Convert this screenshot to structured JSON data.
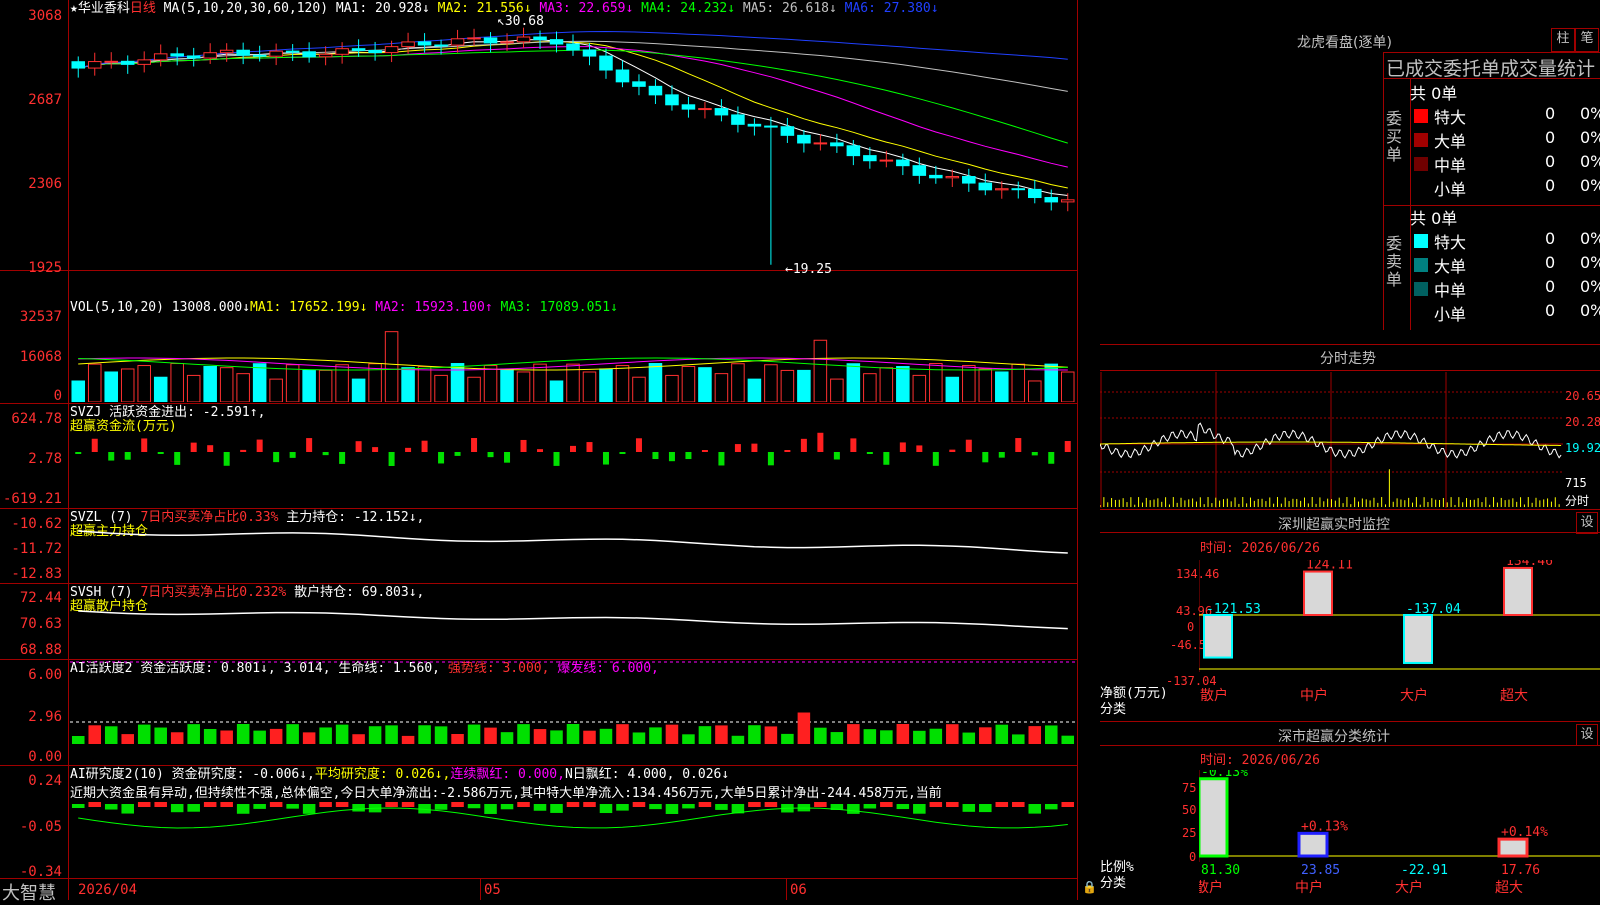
{
  "app": {
    "brand": "大智慧"
  },
  "main": {
    "stock_name": "★华业香科",
    "period": "日线",
    "ma_params": "MA(5,10,20,30,60,120)",
    "ma": [
      {
        "label": "MA1:",
        "value": "20.928↓",
        "color": "#ffffff"
      },
      {
        "label": "MA2:",
        "value": "21.556↓",
        "color": "#ffff00"
      },
      {
        "label": "MA3:",
        "value": "22.659↓",
        "color": "#ff00ff"
      },
      {
        "label": "MA4:",
        "value": "24.232↓",
        "color": "#00ff00"
      },
      {
        "label": "MA5:",
        "value": "26.618↓",
        "color": "#c0c0c0"
      },
      {
        "label": "MA6:",
        "value": "27.380↓",
        "color": "#2040ff"
      }
    ],
    "y_labels": [
      "3068",
      "2687",
      "2306",
      "1925"
    ],
    "high_marker": "30.68",
    "low_marker": "←19.25"
  },
  "vol": {
    "title": "VOL(5,10,20)",
    "value": "13008.000↓",
    "ma1": "MA1: 17652.199↓",
    "ma2": "MA2: 15923.100↑",
    "ma3": "MA3: 17089.051↓",
    "y_labels": [
      "32537",
      "16068",
      "0"
    ]
  },
  "svzj": {
    "title": "SVZJ  活跃资金进出: -2.591↑,",
    "subtitle": "超赢资金流(万元)",
    "y_labels": [
      "624.78",
      "2.78",
      "-619.21"
    ]
  },
  "svzl": {
    "prefix": "SVZL (7)",
    "red_text": "7日内买卖净占比0.33%",
    "rest": "主力持仓: -12.152↓,",
    "subtitle": "超赢主力持仓",
    "y_labels": [
      "-10.62",
      "-11.72",
      "-12.83"
    ]
  },
  "svsh": {
    "prefix": "SVSH (7)",
    "red_text": "7日内买卖净占比0.232%",
    "rest": "散户持仓: 69.803↓,",
    "subtitle": "超赢散户持仓",
    "y_labels": [
      "72.44",
      "70.63",
      "68.88"
    ]
  },
  "ai1": {
    "title": "AI活跃度2 资金活跃度: 0.801↓, 3.014, 生命线: 1.560,",
    "strong": "强势线: 3.000,",
    "burst": "爆发线: 6.000,",
    "y_labels": [
      "6.00",
      "2.96",
      "0.00"
    ]
  },
  "ai2": {
    "title": "AI研究度2(10) 资金研究度: -0.006↓,",
    "avg": "平均研究度: 0.026↓,",
    "cont": "连续飘红: 0.000,",
    "nday": "N日飘红: 4.000, 0.026↓",
    "note": "近期大资金虽有异动,但持续性不强,总体偏空,今日大单净流出:-2.586万元,其中特大单净流入:134.456万元,大单5日累计净出-244.458万元,当前",
    "y_labels": [
      "0.24",
      "-0.05",
      "-0.34"
    ]
  },
  "x_axis": [
    "2026/04",
    "05",
    "06"
  ],
  "right": {
    "lhb": {
      "title": "龙虎看盘(逐单)",
      "btn_bar": "柱",
      "btn_pen": "笔",
      "header": "已成交委托单成交量统计",
      "buy_label": "委买单",
      "sell_label": "委卖单",
      "buy_total": "共 0单",
      "sell_total": "共 0单",
      "buy_rows": [
        {
          "name": "特大",
          "count": "0",
          "pct": "0%",
          "color": "#ff0000"
        },
        {
          "name": "大单",
          "count": "0",
          "pct": "0%",
          "color": "#a00000"
        },
        {
          "name": "中单",
          "count": "0",
          "pct": "0%",
          "color": "#700000"
        },
        {
          "name": "小单",
          "count": "0",
          "pct": "0%",
          "color": ""
        }
      ],
      "sell_rows": [
        {
          "name": "特大",
          "count": "0",
          "pct": "0%",
          "color": "#00ffff"
        },
        {
          "name": "大单",
          "count": "0",
          "pct": "0%",
          "color": "#008080"
        },
        {
          "name": "中单",
          "count": "0",
          "pct": "0%",
          "color": "#006060"
        },
        {
          "name": "小单",
          "count": "0",
          "pct": "0%",
          "color": ""
        }
      ]
    },
    "intraday": {
      "title": "分时走势",
      "prices": [
        "20.65",
        "20.28",
        "19.92"
      ],
      "vol": "715",
      "vol_unit": "分时"
    },
    "sz_monitor": {
      "title": "深圳超赢实时监控",
      "btn": "设",
      "time": "时间: 2026/06/26",
      "y_labels": [
        "134.46",
        "43.96",
        "0",
        "-46.54",
        "-137.04"
      ],
      "y_unit": "净额(万元)",
      "cat_label": "分类",
      "cats": [
        "散户",
        "中户",
        "大户",
        "超大"
      ],
      "values": [
        "-121.53",
        "124.11",
        "-137.04",
        "134.46"
      ]
    },
    "sz_class": {
      "title": "深市超赢分类统计",
      "btn": "设",
      "time": "时间: 2026/06/26",
      "y_labels": [
        "75",
        "50",
        "25",
        "0"
      ],
      "y_unit": "比例%",
      "cat_label": "分类",
      "cats": [
        "散户",
        "中户",
        "大户",
        "超大"
      ],
      "top_labels": [
        "-0.13%",
        "+0.13%",
        "",
        "+0.14%"
      ],
      "values": [
        "81.30",
        "23.85",
        "-22.91",
        "17.76"
      ]
    }
  }
}
